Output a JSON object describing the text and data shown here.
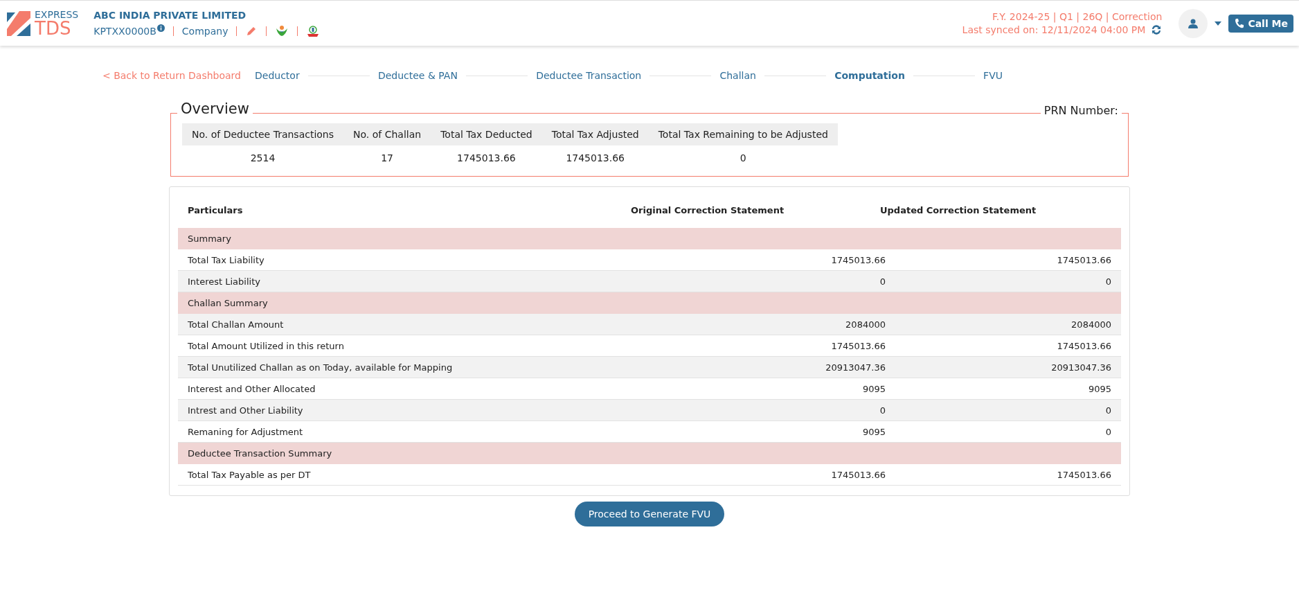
{
  "header": {
    "logo_top": "EXPRESS",
    "logo_bottom": "TDS",
    "company": "ABC INDIA PRIVATE LIMITED",
    "tan": "KPTXX0000B",
    "type": "Company",
    "period": "F.Y. 2024-25  | Q1  | 26Q | Correction",
    "synced": "Last synced on: 12/11/2024 04:00 PM",
    "call_button": "Call Me"
  },
  "nav": {
    "back": "< Back to Return Dashboard",
    "steps": [
      {
        "label": "Deductor",
        "selected": false
      },
      {
        "label": "Deductee & PAN",
        "selected": false
      },
      {
        "label": "Deductee Transaction",
        "selected": false
      },
      {
        "label": "Challan",
        "selected": false
      },
      {
        "label": "Computation",
        "selected": true
      },
      {
        "label": "FVU",
        "selected": false
      }
    ]
  },
  "overview": {
    "title": "Overview",
    "prn_label": "PRN Number:",
    "columns": [
      "No. of Deductee Transactions",
      "No. of Challan",
      "Total Tax Deducted",
      "Total Tax Adjusted",
      "Total Tax Remaining to be Adjusted"
    ],
    "values": [
      "2514",
      "17",
      "1745013.66",
      "1745013.66",
      "0"
    ]
  },
  "table": {
    "columns": [
      "Particulars",
      "Original Correction Statement",
      "Updated Correction Statement"
    ],
    "rows": [
      {
        "kind": "section",
        "label": "Summary"
      },
      {
        "kind": "row",
        "label": "Total Tax Liability",
        "original": "1745013.66",
        "updated": "1745013.66"
      },
      {
        "kind": "row",
        "label": "Interest Liability",
        "original": "0",
        "updated": "0"
      },
      {
        "kind": "section",
        "label": "Challan Summary"
      },
      {
        "kind": "row",
        "label": "Total Challan Amount",
        "original": "2084000",
        "updated": "2084000"
      },
      {
        "kind": "row",
        "label": "Total Amount Utilized in this return",
        "original": "1745013.66",
        "updated": "1745013.66"
      },
      {
        "kind": "row",
        "label": "Total Unutilized Challan as on Today, available for Mapping",
        "original": "20913047.36",
        "updated": "20913047.36"
      },
      {
        "kind": "row",
        "label": "Interest and Other Allocated",
        "original": "9095",
        "updated": "9095"
      },
      {
        "kind": "row",
        "label": "Intrest and Other Liability",
        "original": "0",
        "updated": "0"
      },
      {
        "kind": "row",
        "label": "Remaning for Adjustment",
        "original": "9095",
        "updated": "0"
      },
      {
        "kind": "section",
        "label": "Deductee Transaction Summary"
      },
      {
        "kind": "row",
        "label": "Total Tax Payable as per DT",
        "original": "1745013.66",
        "updated": "1745013.66"
      }
    ]
  },
  "proceed_button": "Proceed to Generate FVU"
}
